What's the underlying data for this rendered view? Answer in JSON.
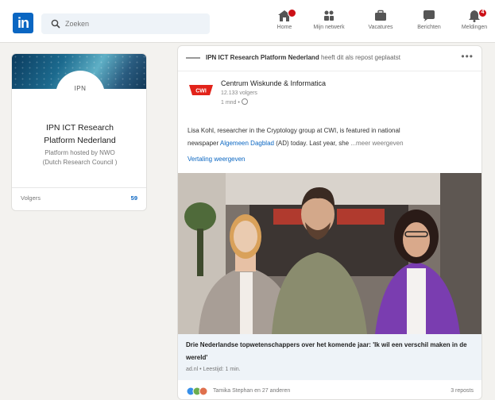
{
  "topbar": {
    "logo_text": "in",
    "search_placeholder": "Zoeken",
    "nav": [
      {
        "label": "Home",
        "icon": "home-icon",
        "badge": true
      },
      {
        "label": "Mijn netwerk",
        "icon": "network-icon"
      },
      {
        "label": "Vacatures",
        "icon": "jobs-icon"
      },
      {
        "label": "Berichten",
        "icon": "messaging-icon"
      },
      {
        "label": "Meldingen",
        "icon": "bell-icon",
        "badge_count": "4"
      }
    ]
  },
  "profile": {
    "logo_text": "IPN",
    "name_line1": "IPN ICT Research",
    "name_line2": "Platform Nederland",
    "desc_line1": "Platform hosted by NWO",
    "desc_line2": "(Dutch Research Council )",
    "followers_label": "Volgers",
    "followers_count": "59"
  },
  "post": {
    "repost_org": "IPN ICT Research Platform Nederland",
    "repost_suffix": " heeft dit als repost geplaatst",
    "more": "•••",
    "author_logo_text": "CWI",
    "author_name": "Centrum Wiskunde & Informatica",
    "author_followers": "12.133 volgers",
    "author_time": "1 mnd •",
    "text_line1": "Lisa Kohl, researcher in the Cryptology group at CWI, is featured in national",
    "text_line2_pre": "newspaper ",
    "text_line2_link": "Algemeen Dagblad",
    "text_line2_post": " (AD) today. Last year, she",
    "text_more": "...meer weergeven",
    "translate": "Vertaling weergeven",
    "article_title": "Drie Nederlandse topwetenschappers over het komende jaar: 'Ik wil een verschil maken in de wereld'",
    "article_meta": "ad.nl • Leestijd: 1 min.",
    "reactions_text": "Tamika Stephan en 27 anderen",
    "reposts": "3 reposts"
  },
  "colors": {
    "accent": "#0a66c2",
    "badge": "#cc1016",
    "background": "#f3f2ef"
  }
}
